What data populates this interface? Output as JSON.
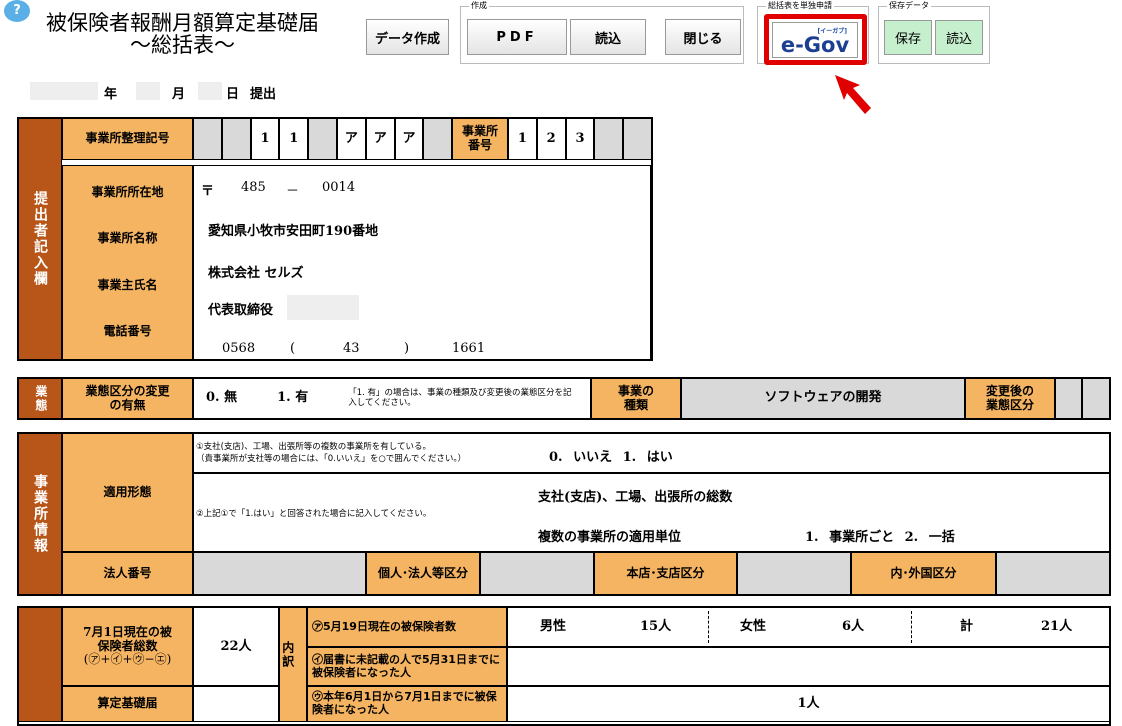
{
  "header": {
    "title_line1": "被保険者報酬月額算定基礎届",
    "title_line2": "～総括表～",
    "help": "?"
  },
  "toolbar": {
    "data_create": "データ作成",
    "group_create": "作成",
    "pdf": "PDF",
    "read": "読込",
    "close": "閉じる",
    "group_egov": "総括表を単独申請",
    "egov_logo": "e-Gov",
    "egov_ruby": "[イーガブ]",
    "group_save": "保存データ",
    "save": "保存",
    "load": "読込"
  },
  "submit_line": {
    "year": "年",
    "month": "月",
    "day": "日",
    "submit": "提出"
  },
  "s1": {
    "side": "提出者記入欄",
    "office_code_label": "事業所整理記号",
    "office_code": [
      "",
      "",
      "1",
      "1",
      "",
      "ア",
      "ア",
      "ア",
      ""
    ],
    "office_no_label": "事業所番号",
    "office_no": [
      "1",
      "2",
      "3",
      "",
      ""
    ],
    "addr_label": "事業所所在地",
    "postal_mark": "〒",
    "postal1": "485",
    "postal_dash": "－",
    "postal2": "0014",
    "address": "愛知県小牧市安田町190番地",
    "name_label": "事業所名称",
    "name": "株式会社 セルズ",
    "owner_label": "事業主氏名",
    "owner": "代表取締役",
    "tel_label": "電話番号",
    "tel1": "0568",
    "tel_open": "(",
    "tel2": "43",
    "tel_close": ")",
    "tel3": "1661"
  },
  "s2": {
    "side": "業態",
    "change_label": "業態区分の変更の有無",
    "opt0": "0. 無",
    "opt1": "1. 有",
    "note": "「1. 有」の場合は、事業の種類及び変更後の業態区分を記入してください。",
    "type_label": "事業の種類",
    "type": "ソフトウェアの開発",
    "after_label": "変更後の業態区分"
  },
  "s3": {
    "side": "事業所情報",
    "apply_label": "適用形態",
    "q1": "①支社(支店)、工場、出張所等の複数の事業所を有している。",
    "q1b": "（貴事業所が支社等の場合には、「0.いいえ」を○で囲んでください。）",
    "q1_opts": "0. いいえ 1. はい",
    "total_label": "支社(支店)、工場、出張所の総数",
    "q2": "②上記①で「1.はい」と回答された場合に記入してください。",
    "unit_label": "複数の事業所の適用単位",
    "unit_opts": "1. 事業所ごと 2. 一括",
    "corp_no": "法人番号",
    "corp_type": "個人･法人等区分",
    "branch": "本店･支店区分",
    "domestic": "内･外国区分"
  },
  "s4": {
    "total_label": "7月1日現在の被保険者総数",
    "total_formula": "(㋐+㋑+㋒−㋓)",
    "total": "22人",
    "breakdown": "内訳",
    "a_label": "㋐5月19日現在の被保険者数",
    "male": "男性",
    "male_n": "15人",
    "female": "女性",
    "female_n": "6人",
    "sum": "計",
    "sum_n": "21人",
    "b_label": "㋑届書に未記載の人で5月31日までに被保険者になった人",
    "c_label": "㋒本年6月1日から7月1日までに被保険者になった人",
    "c_n": "1人",
    "base_label": "算定基礎届"
  }
}
